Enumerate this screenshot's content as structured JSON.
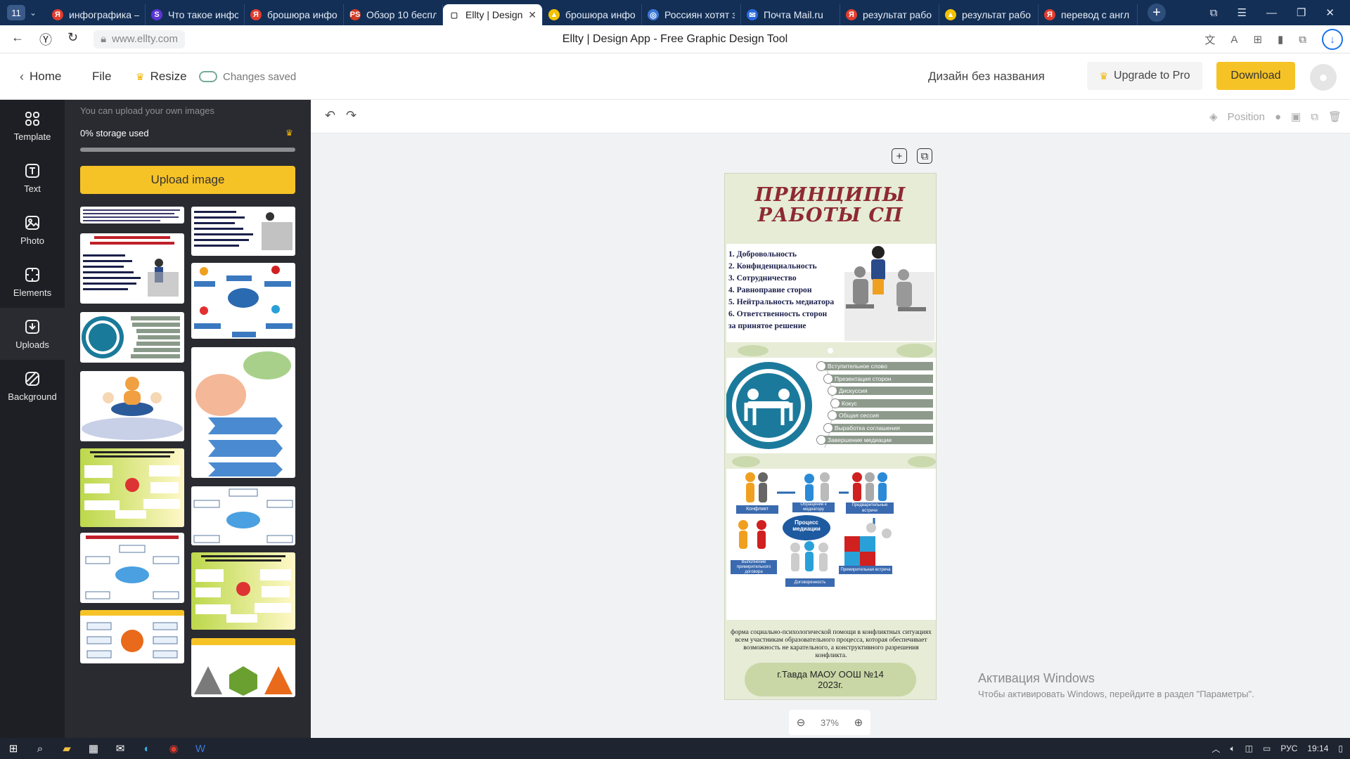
{
  "browser": {
    "tab_count": "11",
    "tabs": [
      {
        "title": "инфографика –",
        "color": "#e23c2e",
        "glyph": "Я"
      },
      {
        "title": "Что такое инфо",
        "color": "#5b35d5",
        "glyph": "S"
      },
      {
        "title": "брошюра инфо",
        "color": "#e23c2e",
        "glyph": "Я"
      },
      {
        "title": "Обзор 10 беспл",
        "color": "#d23a24",
        "glyph": "PS"
      },
      {
        "title": "Ellty | Design",
        "color": "#ffffff",
        "glyph": "▢",
        "active": true
      },
      {
        "title": "брошюра инфо",
        "color": "#f3c200",
        "glyph": "▲"
      },
      {
        "title": "Россиян хотят з",
        "color": "#3a77d8",
        "glyph": "◎"
      },
      {
        "title": "Почта Mail.ru",
        "color": "#2a6ae0",
        "glyph": "✉"
      },
      {
        "title": "результат рабо",
        "color": "#e23c2e",
        "glyph": "Я"
      },
      {
        "title": "результат рабо",
        "color": "#f3c200",
        "glyph": "▲"
      },
      {
        "title": "перевод с англ",
        "color": "#e23c2e",
        "glyph": "Я"
      }
    ],
    "url": "www.ellty.com",
    "page_title": "Ellty | Design App - Free Graphic Design Tool"
  },
  "header": {
    "home": "Home",
    "file": "File",
    "resize": "Resize",
    "saved": "Changes saved",
    "design_name": "Дизайн без названия",
    "upgrade": "Upgrade to Pro",
    "download": "Download"
  },
  "rail": {
    "items": [
      {
        "label": "Template",
        "icon": "grid-icon"
      },
      {
        "label": "Text",
        "icon": "text-icon"
      },
      {
        "label": "Photo",
        "icon": "photo-icon"
      },
      {
        "label": "Elements",
        "icon": "elements-icon"
      },
      {
        "label": "Uploads",
        "icon": "upload-icon"
      },
      {
        "label": "Background",
        "icon": "background-icon"
      }
    ]
  },
  "panel": {
    "hint": "You can upload your own images",
    "storage": "0% storage used",
    "storage_fraction": 0,
    "upload": "Upload image"
  },
  "toolbar": {
    "position": "Position"
  },
  "design": {
    "title_line1": "ПРИНЦИПЫ",
    "title_line2": "РАБОТЫ СП",
    "principles": [
      "1. Добровольность",
      "2. Конфиденциальность",
      "3. Сотрудничество",
      "4. Равноправие сторон",
      "5. Нейтральность медиатора",
      "6. Ответственность сторон",
      "за принятое решение"
    ],
    "stages": [
      "Вступительное слово",
      "Презентация сторон",
      "Дискуссия",
      "Кокус",
      "Общая сессия",
      "Выработка соглашения",
      "Завершение медиации"
    ],
    "process": {
      "center": "Процесс медиации",
      "conflict": "Конфликт",
      "appeal": "Обращение к медиатору",
      "pre_meeting": "Предварительные встречи",
      "reconcile": "Примирительная встреча",
      "agreement": "Договоренность",
      "fulfilment": "Выполнение примирительного договора"
    },
    "description": "форма социально-психологической помощи в конфликтных ситуациях всем участникам образовательного процесса, которая обеспечивает возможность не карательного, а конструктивного разрешения конфликта.",
    "footer1": "г.Тавда МАОУ ООШ №14",
    "footer2": "2023г."
  },
  "zoom": "37%",
  "activation": {
    "title": "Активация Windows",
    "body": "Чтобы активировать Windows, перейдите в раздел \"Параметры\"."
  },
  "taskbar": {
    "lang": "РУС",
    "time": "19:14"
  }
}
